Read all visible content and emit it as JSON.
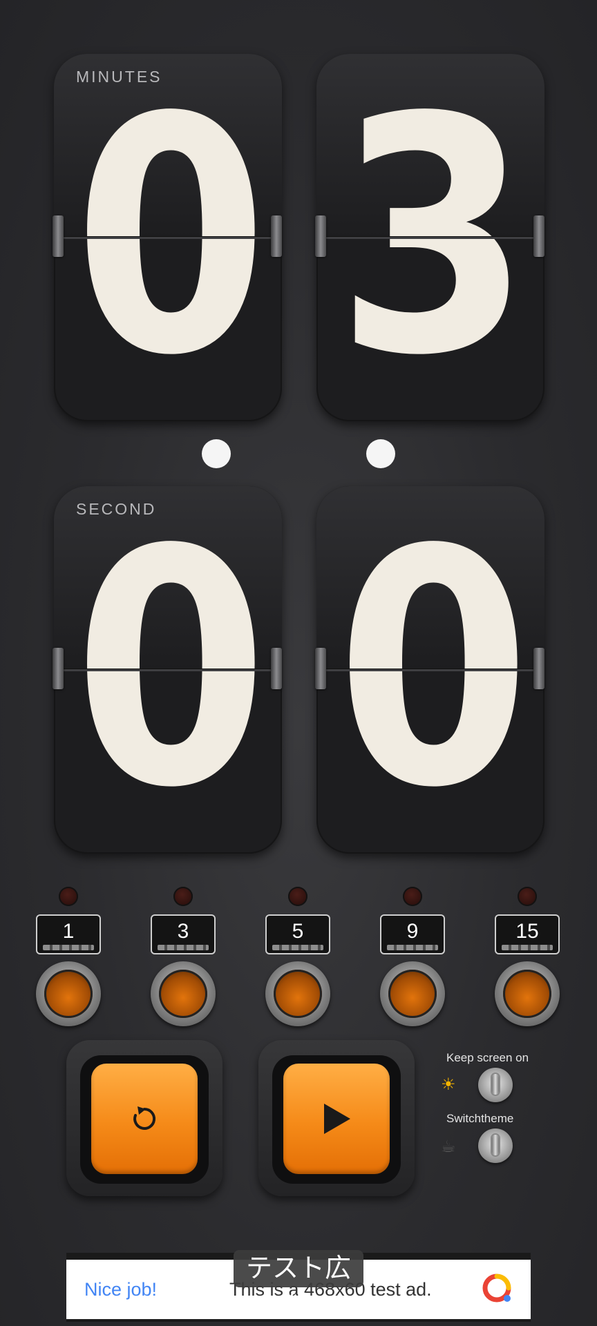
{
  "timer": {
    "minutes_label": "MINUTES",
    "seconds_label": "SECOND",
    "minute_tens": "0",
    "minute_ones": "3",
    "second_tens": "0",
    "second_ones": "0"
  },
  "presets": [
    {
      "label": "1"
    },
    {
      "label": "3"
    },
    {
      "label": "5"
    },
    {
      "label": "9"
    },
    {
      "label": "15"
    }
  ],
  "controls": {
    "reset_icon": "reset-icon",
    "play_icon": "play-icon"
  },
  "toggles": {
    "keep_screen_label": "Keep screen on",
    "switch_theme_label": "Switchtheme",
    "sun_icon": "☀",
    "theme_icon": "☕"
  },
  "ad": {
    "tag": "テスト広告",
    "cta": "Nice job!",
    "text": "This is a 468x60 test ad."
  },
  "colors": {
    "digit": "#f1ece2",
    "accent_orange": "#f58a18",
    "ad_blue": "#4285f4"
  }
}
